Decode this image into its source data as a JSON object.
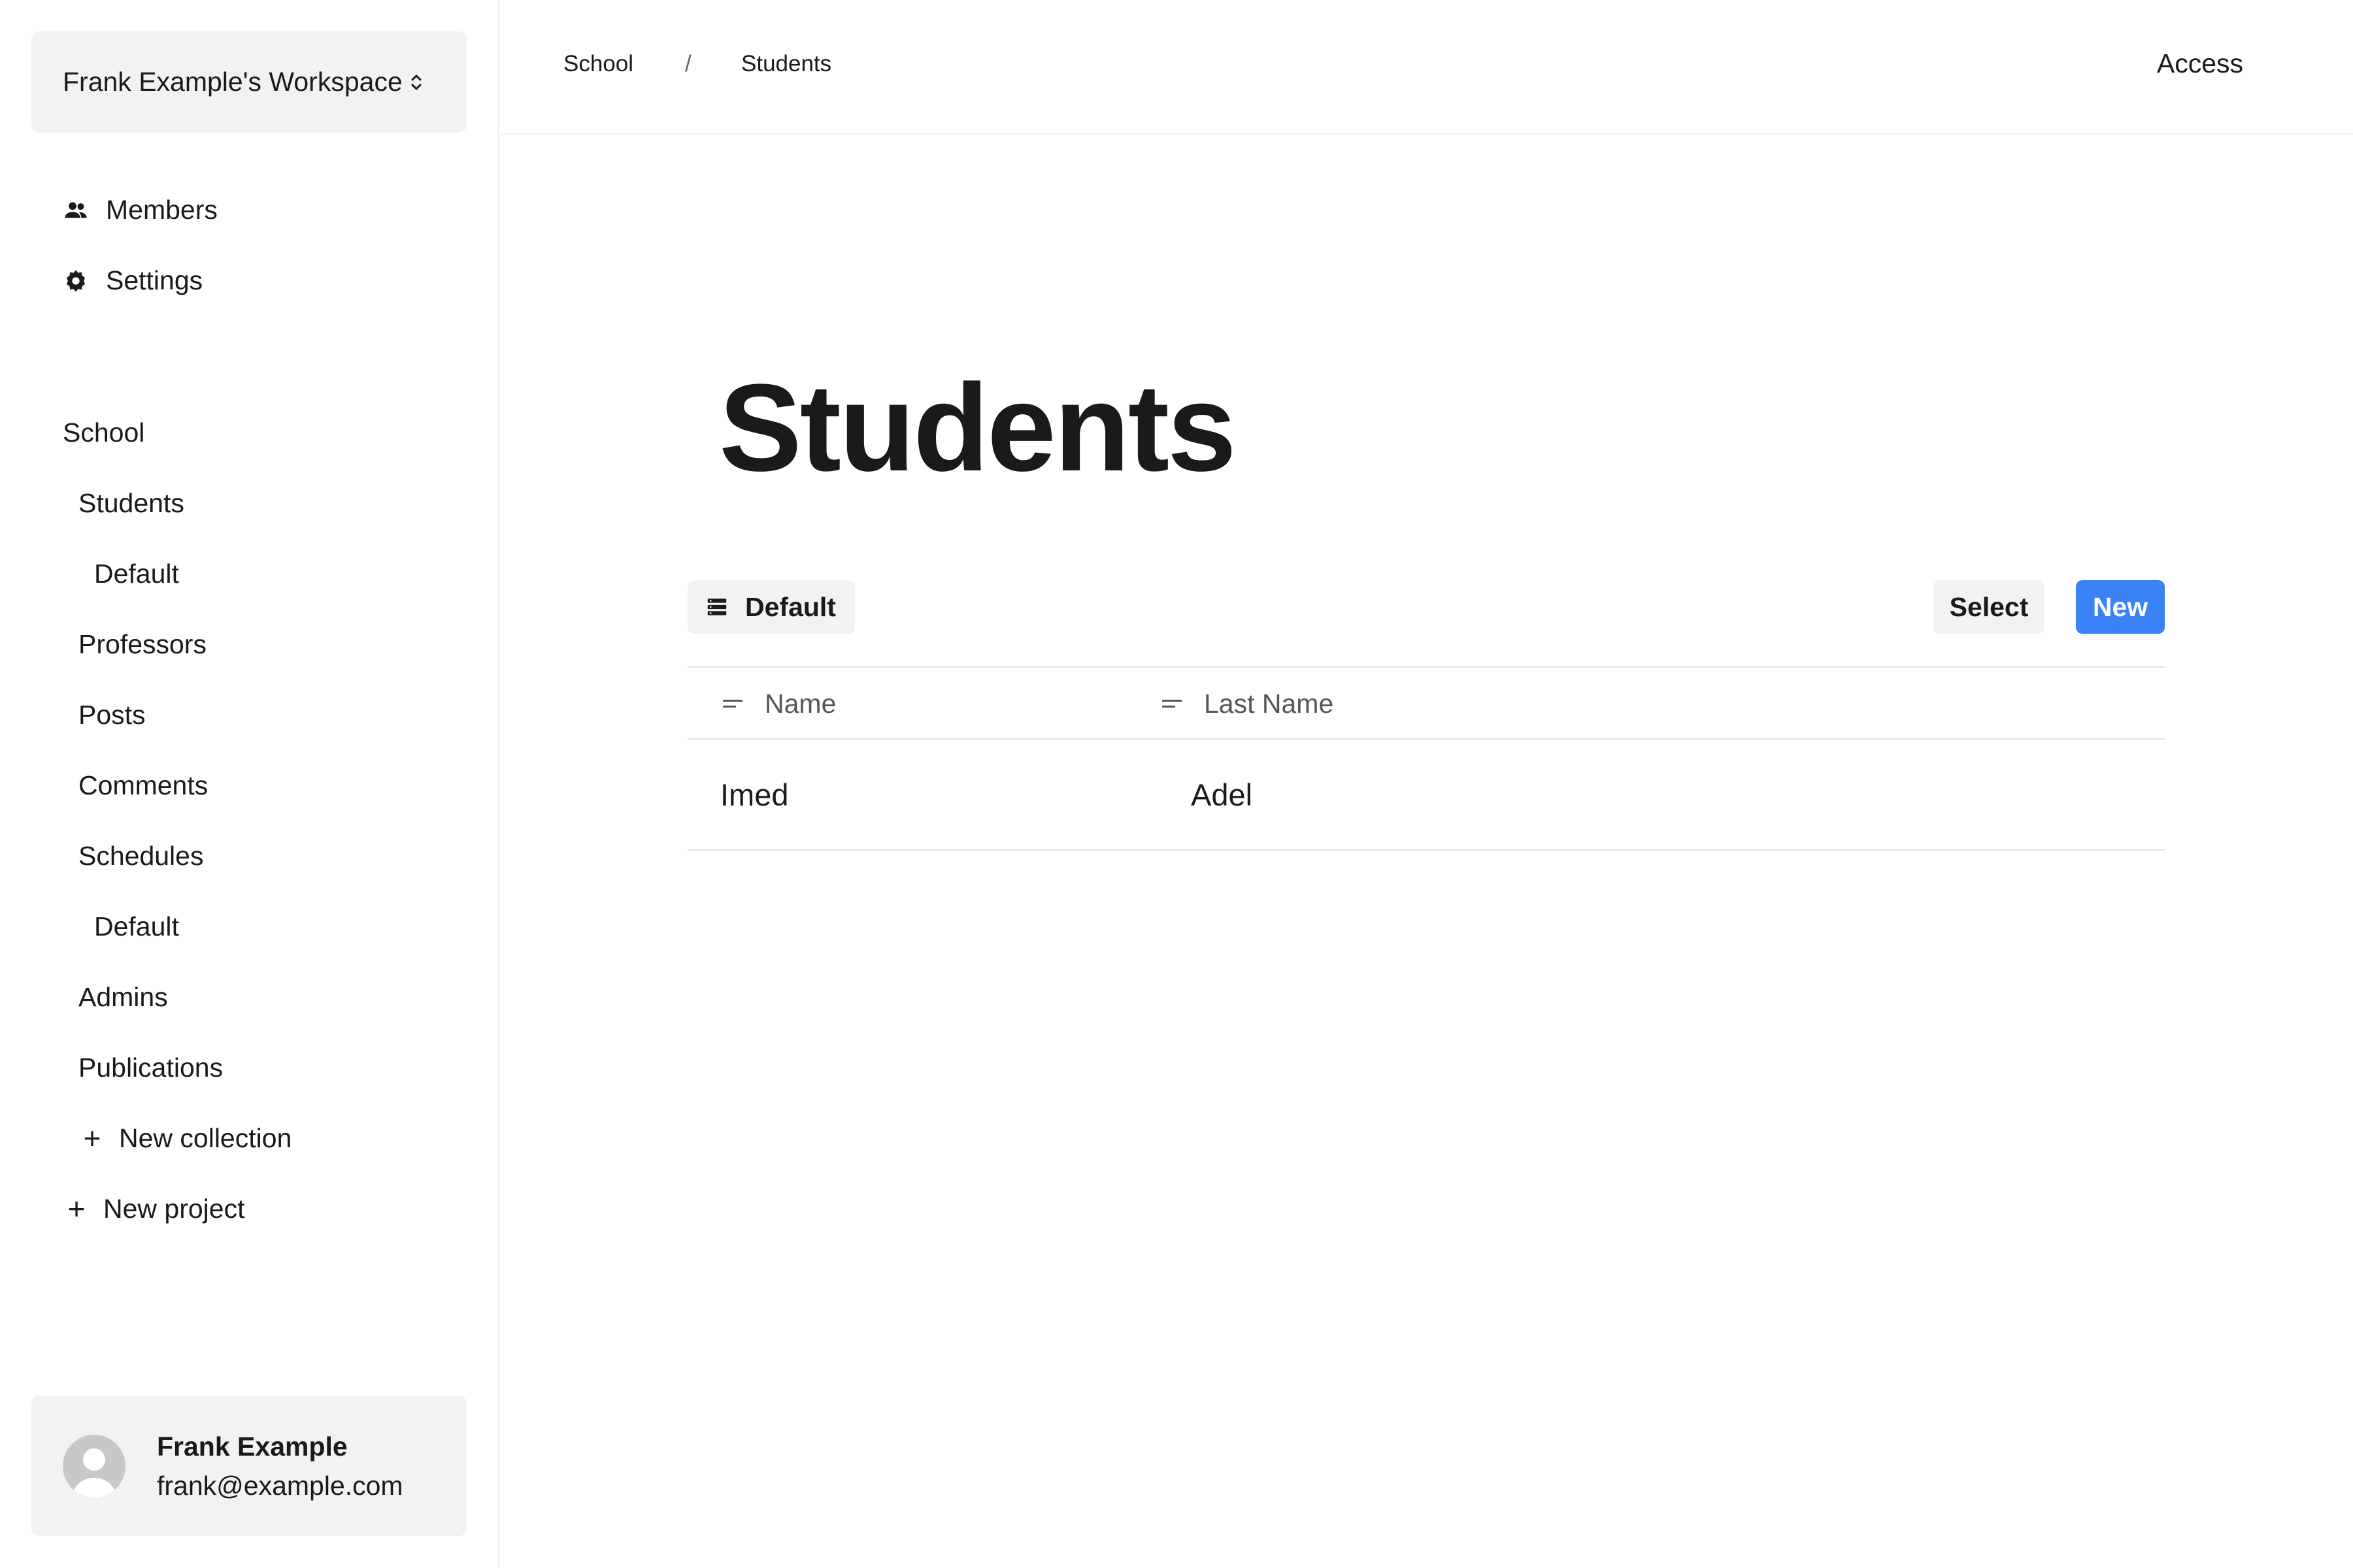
{
  "sidebar": {
    "workspace_name": "Frank Example's Workspace",
    "nav": [
      {
        "label": "Members",
        "icon": "members-icon"
      },
      {
        "label": "Settings",
        "icon": "gear-icon"
      }
    ],
    "project": {
      "label": "School",
      "collections": [
        {
          "label": "Students",
          "views": [
            {
              "label": "Default"
            }
          ]
        },
        {
          "label": "Professors"
        },
        {
          "label": "Posts"
        },
        {
          "label": "Comments"
        },
        {
          "label": "Schedules",
          "views": [
            {
              "label": "Default"
            }
          ]
        },
        {
          "label": "Admins"
        },
        {
          "label": "Publications"
        }
      ],
      "new_collection_label": "New collection"
    },
    "new_project_label": "New project",
    "user": {
      "name": "Frank Example",
      "email": "frank@example.com"
    }
  },
  "topbar": {
    "breadcrumb": [
      "School",
      "Students"
    ],
    "separator": "/",
    "access_label": "Access"
  },
  "main": {
    "title": "Students",
    "view_label": "Default",
    "select_label": "Select",
    "new_label": "New",
    "table": {
      "columns": [
        "Name",
        "Last Name"
      ],
      "rows": [
        [
          "Imed",
          "Adel"
        ]
      ]
    }
  },
  "colors": {
    "accent": "#3b82f6",
    "panel_bg": "#f2f2f2",
    "border": "#e2e2e2"
  }
}
